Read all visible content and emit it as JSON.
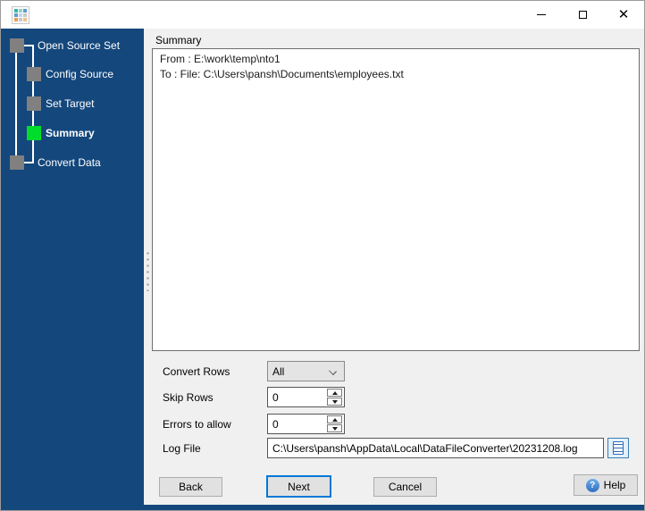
{
  "window": {
    "title": "",
    "icons": {
      "app": "app-icon",
      "minimize": "minimize-icon",
      "maximize": "maximize-icon",
      "close": "close-icon",
      "help": "help-question-icon",
      "browse": "view-log-file-icon",
      "combo_chevron": "chevron-down-icon"
    },
    "controls": {
      "close_glyph": "✕"
    }
  },
  "sidebar": {
    "steps": [
      {
        "label": "Open Source Set",
        "state": "completed"
      },
      {
        "label": "Config Source",
        "state": "completed"
      },
      {
        "label": "Set Target",
        "state": "completed"
      },
      {
        "label": "Summary",
        "state": "active"
      },
      {
        "label": "Convert Data",
        "state": "pending"
      }
    ]
  },
  "main": {
    "summary_label": "Summary",
    "summary": {
      "line1": "From : E:\\work\\temp\\nto1",
      "line2": "To : File: C:\\Users\\pansh\\Documents\\employees.txt"
    },
    "form": {
      "convert_rows_label": "Convert Rows",
      "convert_rows_value": "All",
      "skip_rows_label": "Skip Rows",
      "skip_rows_value": "0",
      "errors_label": "Errors to allow",
      "errors_value": "0",
      "log_file_label": "Log File",
      "log_file_value": "C:\\Users\\pansh\\AppData\\Local\\DataFileConverter\\20231208.log"
    },
    "buttons": {
      "back": "Back",
      "next": "Next",
      "cancel": "Cancel",
      "help": "Help"
    }
  },
  "colors": {
    "sidebar_bg": "#14477c",
    "active_step": "#00dc2b",
    "pending_step": "#808080",
    "accent_blue": "#0078d7",
    "panel_bg": "#f0f0f0"
  }
}
